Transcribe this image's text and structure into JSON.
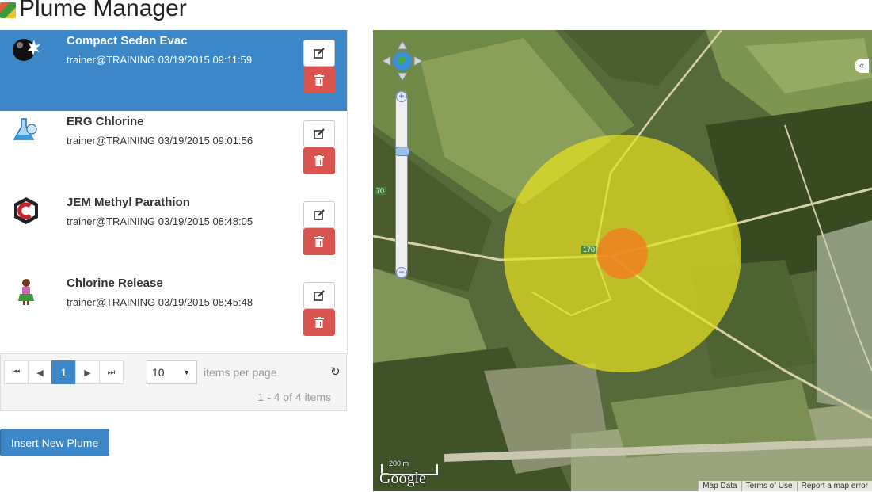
{
  "header": {
    "title": "Plume Manager",
    "icon": "map-icon"
  },
  "plumes": [
    {
      "name": "Compact Sedan Evac",
      "meta": "trainer@TRAINING 03/19/2015 09:11:59",
      "icon": "explosion-icon",
      "selected": true
    },
    {
      "name": "ERG Chlorine",
      "meta": "trainer@TRAINING 03/19/2015 09:01:56",
      "icon": "flask-icon",
      "selected": false
    },
    {
      "name": "JEM Methyl Parathion",
      "meta": "trainer@TRAINING 03/19/2015 08:48:05",
      "icon": "hazard-c-icon",
      "selected": false
    },
    {
      "name": "Chlorine Release",
      "meta": "trainer@TRAINING 03/19/2015 08:45:48",
      "icon": "person-icon",
      "selected": false
    }
  ],
  "pager": {
    "current_page": "1",
    "page_size": "10",
    "items_per_page_label": "items per page",
    "count_label": "1 - 4 of 4 items"
  },
  "actions": {
    "insert_label": "Insert New Plume"
  },
  "map": {
    "route_label_left": "70",
    "route_label_center": "170",
    "scale_label": "200 m",
    "logo": "Google",
    "footer": [
      "Map Data",
      "Terms of Use",
      "Report a map error"
    ],
    "outer_zone_color": "#e6e020",
    "inner_zone_color": "#f08020"
  },
  "colors": {
    "accent": "#3b87c8",
    "danger": "#d9534f"
  }
}
